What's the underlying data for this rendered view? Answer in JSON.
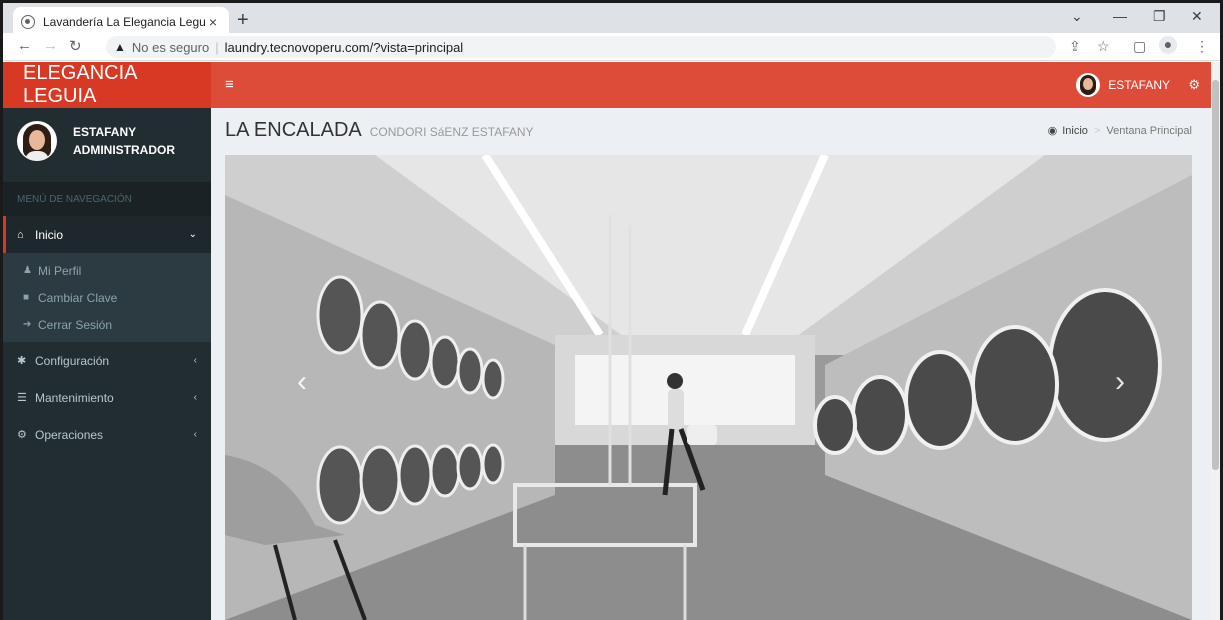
{
  "browser": {
    "tab_title": "Lavandería La Elegancia Leguía",
    "tab_close": "×",
    "new_tab": "+",
    "insecure_label": "No es seguro",
    "url": "laundry.tecnovoperu.com/?vista=principal"
  },
  "app": {
    "logo": "ELEGANCIA LEGUIA",
    "user": {
      "name": "ESTAFANY",
      "role": "ADMINISTRADOR"
    },
    "nav_header": "MENÚ DE NAVEGACIÓN",
    "menu": {
      "inicio": "Inicio",
      "mi_perfil": "Mi Perfil",
      "cambiar_clave": "Cambiar Clave",
      "cerrar_sesion": "Cerrar Sesión",
      "configuracion": "Configuración",
      "mantenimiento": "Mantenimiento",
      "operaciones": "Operaciones"
    },
    "topnav_user": "ESTAFANY"
  },
  "content": {
    "title": "LA ENCALADA",
    "subtitle": "CONDORI SáENZ ESTAFANY",
    "breadcrumb": {
      "home": "Inicio",
      "current": "Ventana Principal"
    }
  },
  "icons": {
    "favicon": "globe-icon",
    "back": "arrow-left-icon",
    "forward": "arrow-right-icon",
    "reload": "reload-icon",
    "warning": "warning-icon",
    "share": "share-icon",
    "star": "star-icon",
    "sidepanel": "sidepanel-icon",
    "profile": "profile-icon",
    "more": "more-vertical-icon",
    "hamburger": "bars-icon",
    "gears": "gears-icon",
    "home": "home-icon",
    "user": "user-icon",
    "lock": "lock-icon",
    "signout": "sign-out-icon",
    "cog": "cog-icon",
    "database": "database-icon",
    "dashboard": "dashboard-icon"
  },
  "colors": {
    "brand_red": "#dd4b39",
    "logo_red": "#d73925",
    "sidebar": "#222d32",
    "content_bg": "#ecf0f5"
  }
}
